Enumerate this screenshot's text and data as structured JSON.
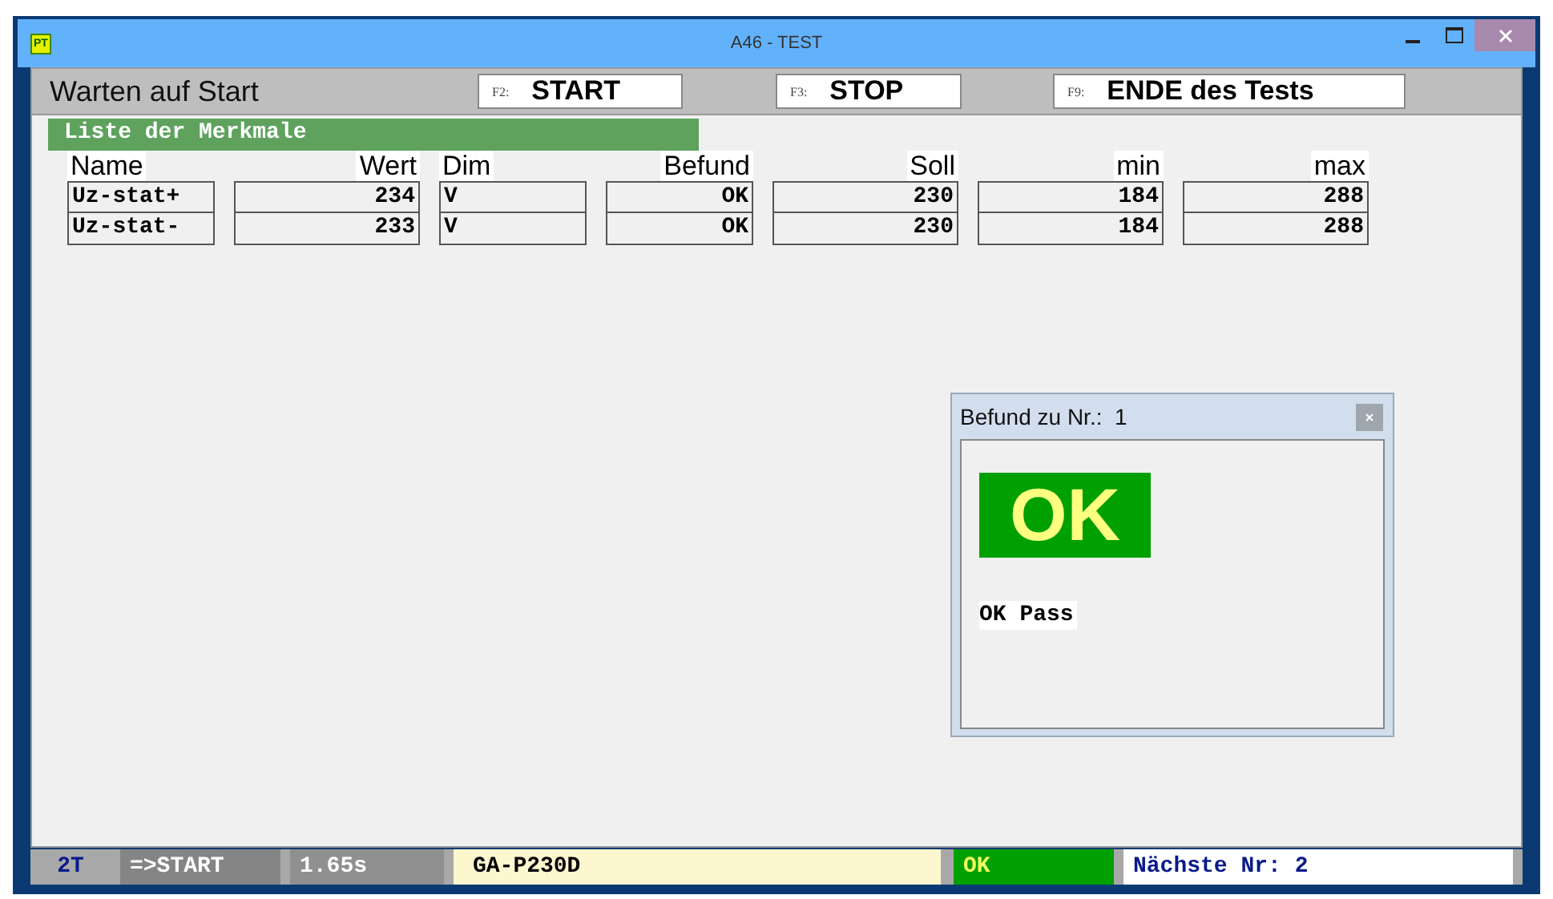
{
  "window": {
    "title": "A46 - TEST",
    "logo": "PT"
  },
  "toolbar": {
    "status": "Warten auf Start",
    "buttons": [
      {
        "key": "F2:",
        "label": "START"
      },
      {
        "key": "F3:",
        "label": "STOP"
      },
      {
        "key": "F9:",
        "label": "ENDE des Tests"
      }
    ]
  },
  "list": {
    "title": "Liste der Merkmale",
    "columns": [
      "Name",
      "Wert",
      "Dim",
      "Befund",
      "Soll",
      "min",
      "max"
    ],
    "rows": [
      [
        "Uz-stat+",
        "234",
        "V",
        "OK",
        "230",
        "184",
        "288"
      ],
      [
        "Uz-stat-",
        "233",
        "V",
        "OK",
        "230",
        "184",
        "288"
      ]
    ]
  },
  "result_window": {
    "title": "Befund zu Nr.:  1",
    "verdict": "OK",
    "message": "OK Pass"
  },
  "status_bar": [
    {
      "kind": "mode",
      "text": "2T"
    },
    {
      "kind": "step",
      "text": "=>START"
    },
    {
      "kind": "time",
      "text": "1.65s"
    },
    {
      "kind": "type",
      "text": "GA-P230D"
    },
    {
      "kind": "result",
      "text": "OK"
    },
    {
      "kind": "next",
      "text": "Nächste Nr: 2"
    }
  ]
}
